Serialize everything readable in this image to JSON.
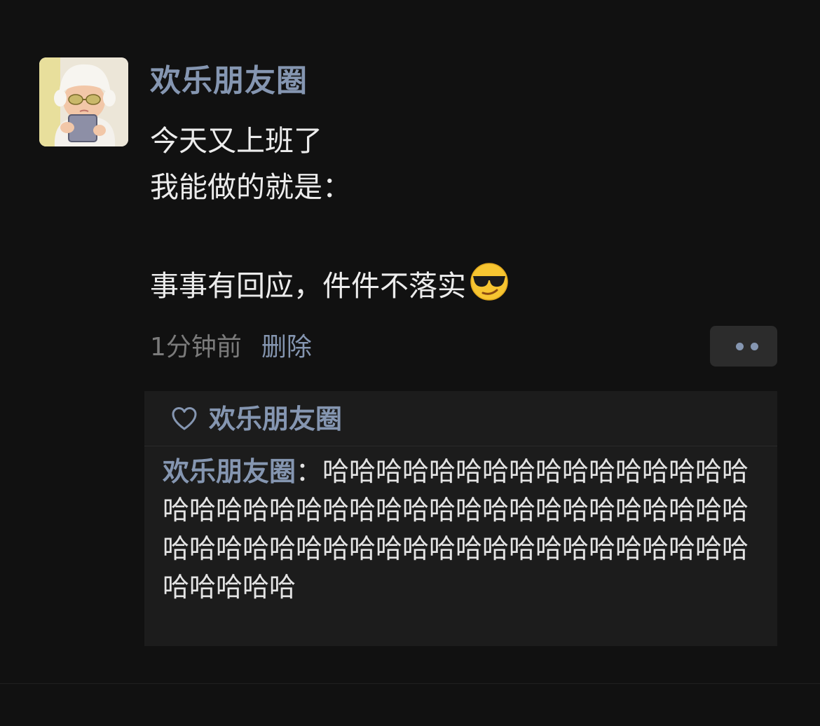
{
  "post": {
    "author": "欢乐朋友圈",
    "content_lines": [
      "今天又上班了",
      "我能做的就是："
    ],
    "content_highlight": "事事有回应，件件不落实",
    "emoji": "sunglasses-face-icon",
    "time": "1分钟前",
    "delete_label": "删除",
    "more_icon": "more-dots-icon"
  },
  "likes": {
    "icon": "heart-icon",
    "names": "欢乐朋友圈"
  },
  "comments": [
    {
      "author": "欢乐朋友圈",
      "separator": "：",
      "text": "哈哈哈哈哈哈哈哈哈哈哈哈哈哈哈哈哈哈哈哈哈哈哈哈哈哈哈哈哈哈哈哈哈哈哈哈哈哈哈哈哈哈哈哈哈哈哈哈哈哈哈哈哈哈哈哈哈哈哈哈哈哈哈哈哈"
    }
  ],
  "colors": {
    "background": "#111111",
    "link_blue": "#8596b1",
    "text": "#ececec",
    "muted": "#7b7b7b",
    "panel": "#1c1c1c"
  }
}
